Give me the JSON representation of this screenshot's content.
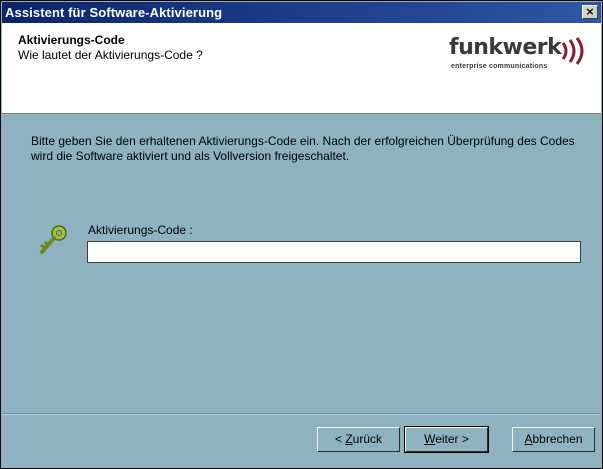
{
  "window": {
    "title": "Assistent für Software-Aktivierung",
    "close_label": "×"
  },
  "header": {
    "title": "Aktivierungs-Code",
    "subtitle": "Wie lautet der Aktivierungs-Code ?",
    "logo_text": "funkwerk",
    "logo_tagline": "enterprise communications"
  },
  "body": {
    "intro_text": "Bitte geben Sie den erhaltenen Aktivierungs-Code ein. Nach der erfolgreichen Überprüfung des Codes wird die Software aktiviert und als Vollversion freigeschaltet.",
    "code_label": "Aktivierungs-Code :",
    "code_value": "",
    "icon": "key-icon"
  },
  "buttons": {
    "back_prefix": "< ",
    "back_mnemonic": "Z",
    "back_rest": "urück",
    "next_mnemonic": "W",
    "next_rest": "eiter >",
    "cancel_mnemonic": "A",
    "cancel_rest": "bbrechen"
  },
  "colors": {
    "background": "#8fb2c1",
    "titlebar": "#0a246a",
    "header_bg": "#ffffff"
  }
}
